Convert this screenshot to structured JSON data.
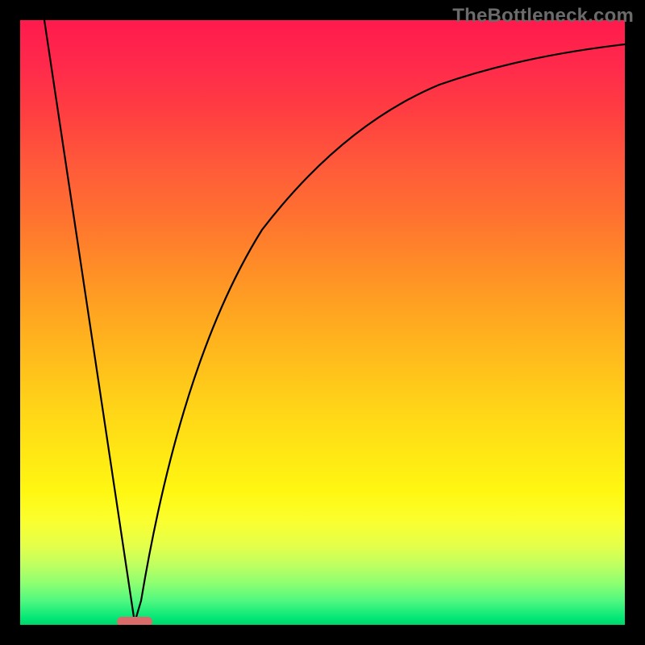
{
  "watermark": "TheBottleneck.com",
  "chart_data": {
    "type": "line",
    "title": "",
    "xlabel": "",
    "ylabel": "",
    "xlim": [
      0,
      100
    ],
    "ylim": [
      0,
      100
    ],
    "grid": false,
    "legend": false,
    "series": [
      {
        "name": "left-descending-line",
        "x": [
          4,
          19
        ],
        "y": [
          100,
          0
        ]
      },
      {
        "name": "right-ascending-curve",
        "x": [
          19,
          22,
          26,
          30,
          35,
          40,
          46,
          52,
          60,
          70,
          82,
          100
        ],
        "y": [
          0,
          13,
          28,
          40,
          51,
          60,
          68,
          74,
          80,
          85,
          89,
          93
        ]
      }
    ],
    "annotations": [
      {
        "name": "vertex-marker",
        "shape": "rounded-rect",
        "x": 19,
        "y": 0,
        "color": "#d96b6b"
      }
    ],
    "gradient_stops_y": {
      "0": "#ff1a4d",
      "50": "#ffbc1c",
      "80": "#fff712",
      "100": "#00d46a"
    }
  }
}
